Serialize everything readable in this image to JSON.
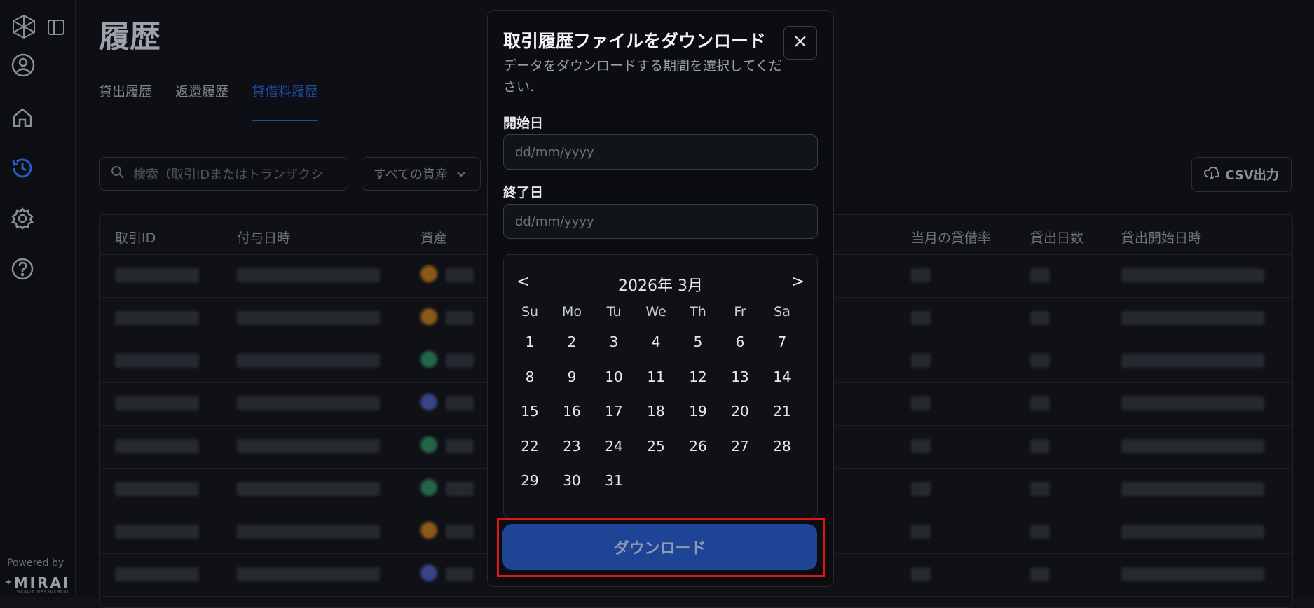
{
  "sidebar": {
    "items": [
      "logo-icon",
      "sidebar-toggle-icon",
      "user-icon",
      "home-icon",
      "history-icon",
      "settings-icon",
      "help-icon"
    ],
    "powered_by": "Powered by",
    "brand": "MIRAI",
    "brand_sub": "WEALTH MANAGEMENT"
  },
  "page": {
    "title": "履歴",
    "tabs": [
      "貸出履歴",
      "返還履歴",
      "貸借料履歴"
    ],
    "active_tab": "貸借料履歴",
    "search_placeholder": "検索（取引IDまたはトランザクシ",
    "asset_filter": "すべての資産",
    "csv_button": "CSV出力",
    "columns": [
      "取引ID",
      "付与日時",
      "資産",
      "当月の貸借率",
      "貸出日数",
      "貸出開始日時"
    ],
    "asset_dot_colors": [
      "#c27a1a",
      "#c27a1a",
      "#2d8a5e",
      "#4a5cb8",
      "#2d8a5e",
      "#2d8a5e",
      "#c27a1a",
      "#4a5cb8"
    ]
  },
  "modal": {
    "title": "取引履歴ファイルをダウンロード",
    "description": "データをダウンロードする期間を選択してください.",
    "start_label": "開始日",
    "start_placeholder": "dd/mm/yyyy",
    "end_label": "終了日",
    "end_placeholder": "dd/mm/yyyy",
    "calendar": {
      "prev": "<",
      "next": ">",
      "month_label": "2026年 3月",
      "weekdays": [
        "Su",
        "Mo",
        "Tu",
        "We",
        "Th",
        "Fr",
        "Sa"
      ],
      "weeks": [
        [
          "1",
          "2",
          "3",
          "4",
          "5",
          "6",
          "7"
        ],
        [
          "8",
          "9",
          "10",
          "11",
          "12",
          "13",
          "14"
        ],
        [
          "15",
          "16",
          "17",
          "18",
          "19",
          "20",
          "21"
        ],
        [
          "22",
          "23",
          "24",
          "25",
          "26",
          "27",
          "28"
        ],
        [
          "29",
          "30",
          "31",
          "",
          "",
          "",
          ""
        ]
      ]
    },
    "download_button": "ダウンロード"
  },
  "colors": {
    "accent": "#1e4ba1",
    "button": "#1d4495",
    "highlight": "#e01616"
  }
}
